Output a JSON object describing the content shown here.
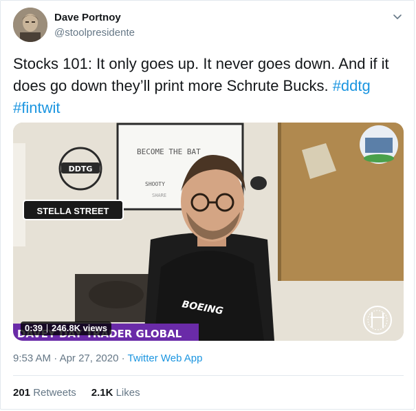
{
  "author": {
    "name": "Dave Portnoy",
    "handle": "@stoolpresidente"
  },
  "tweet": {
    "text_main": "Stocks 101: It only goes up.  It never goes down.  And if it does go down they’ll print more Schrute Bucks. ",
    "hashtags": [
      "#ddtg",
      "#fintwit"
    ]
  },
  "video": {
    "duration": "0:39",
    "views": "246.8K views",
    "whiteboard_title": "BECOME THE BAT",
    "whiteboard_note": "SHOOTY",
    "whiteboard_note2": "SHARE",
    "logo_text": "DDTG",
    "street_sign": "STELLA STREET",
    "shirt_text": "BOEING",
    "banner_text": "DAVEY DAY TRADER GLOBAL"
  },
  "meta": {
    "time": "9:53 AM",
    "date": "Apr 27, 2020",
    "separator": "·",
    "app": "Twitter Web App"
  },
  "stats": {
    "retweets_count": "201",
    "retweets_label": "Retweets",
    "likes_count": "2.1K",
    "likes_label": "Likes"
  },
  "colors": {
    "link": "#1b95e0",
    "secondary_text": "#657786",
    "banner_purple": "#6a2ba8"
  }
}
